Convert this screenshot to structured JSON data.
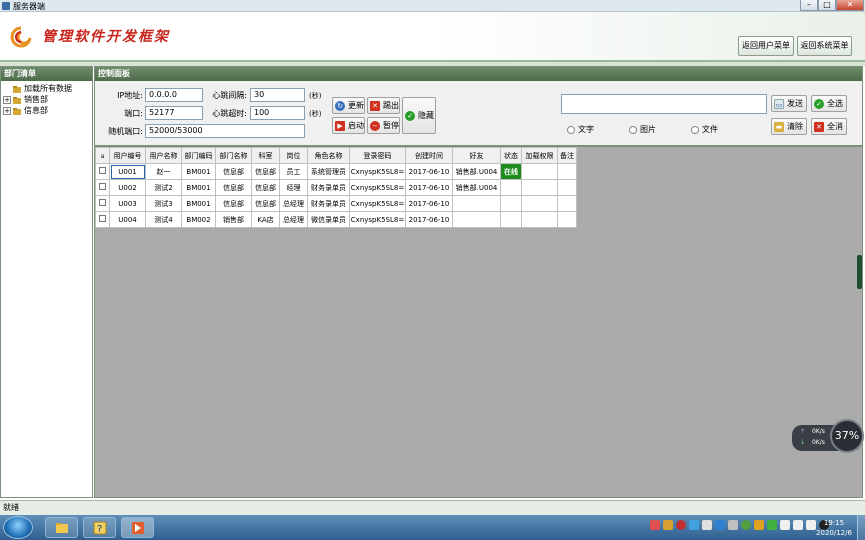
{
  "window": {
    "title": "服务器端",
    "min": "–",
    "max": "□",
    "close": "✕"
  },
  "header": {
    "app_name": "管理软件开发框架",
    "btn_user_menu": "返回用户菜单",
    "btn_sys_menu": "返回系统菜单"
  },
  "left_panel": {
    "title": "部门清单",
    "tree": [
      {
        "label": "加载所有数据",
        "expander": ""
      },
      {
        "label": "销售部",
        "expander": "+"
      },
      {
        "label": "信息部",
        "expander": "+"
      }
    ]
  },
  "control": {
    "title": "控制面板",
    "ip_label": "IP地址:",
    "ip_value": "0.0.0.0",
    "port_label": "端口:",
    "port_value": "52177",
    "random_port_label": "随机端口:",
    "random_port_value": "52000/53000",
    "heartbeat_label": "心跳间隔:",
    "heartbeat_value": "30",
    "heartbeat_unit": "(秒)",
    "timeout_label": "心跳超时:",
    "timeout_value": "100",
    "timeout_unit": "(秒)",
    "btn_update": "更新",
    "btn_exit": "踢出",
    "btn_hide": "隐藏",
    "btn_start": "启动",
    "btn_pause": "暂停",
    "btn_send": "发送",
    "btn_select_all": "全选",
    "btn_clear": "清除",
    "btn_clear_all": "全消",
    "radio_text": "文字",
    "radio_image": "图片",
    "radio_file": "文件"
  },
  "grid": {
    "columns": [
      "",
      "用户编号",
      "用户名称",
      "部门编码",
      "部门名称",
      "科室",
      "岗位",
      "角色名称",
      "登录密码",
      "创建时间",
      "好友",
      "状态",
      "加载权限",
      "备注"
    ],
    "rows": [
      [
        "",
        "U001",
        "赵一",
        "BM001",
        "信息部",
        "信息部",
        "员工",
        "系统管理员",
        "CxnyspK5SL8=",
        "2017-06-10",
        "销售部.U004",
        "在线",
        "",
        ""
      ],
      [
        "",
        "U002",
        "测试2",
        "BM001",
        "信息部",
        "信息部",
        "经理",
        "财务录单员",
        "CxnyspK5SL8=",
        "2017-06-10",
        "销售部.U004",
        "",
        "",
        ""
      ],
      [
        "",
        "U003",
        "测试3",
        "BM001",
        "信息部",
        "信息部",
        "总经理",
        "财务录单员",
        "CxnyspK5SL8=",
        "2017-06-10",
        "",
        "",
        "",
        ""
      ],
      [
        "",
        "U004",
        "测试4",
        "BM002",
        "销售部",
        "KA店",
        "总经理",
        "微信录单员",
        "CxnyspK5SL8=",
        "2017-06-10",
        "",
        "",
        "",
        ""
      ]
    ]
  },
  "net_widget": {
    "up_label": "↑",
    "up_value": "0K/s",
    "down_label": "↓",
    "down_value": "0K/s",
    "percent": "37%"
  },
  "status_bar": {
    "text": "就绪"
  },
  "taskbar": {
    "time": "19:15",
    "date": "2020/12/6"
  },
  "colors": {
    "accent": "#4f6b4b",
    "online": "#1e8c1e",
    "logo": "#c8261c"
  }
}
